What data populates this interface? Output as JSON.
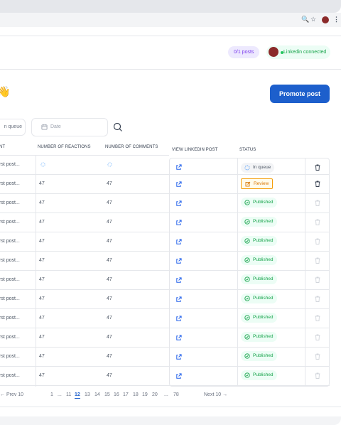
{
  "header": {
    "posts_badge": "0/1 posts",
    "linkedin_status": "Linkedin connected",
    "promote_button": "Promote post"
  },
  "filters": {
    "queue_value": "n queue",
    "date_placeholder": "Date"
  },
  "table": {
    "columns": [
      "NT",
      "NUMBER OF REACTIONS",
      "NUMBER OF COMMENTS",
      "VIEW LINKEDIN POST",
      "STATUS"
    ],
    "rows": [
      {
        "content": "rst post...",
        "reactions": "",
        "comments": "",
        "status": "In queue",
        "status_type": "queue"
      },
      {
        "content": "rst post...",
        "reactions": "47",
        "comments": "47",
        "status": "Review",
        "status_type": "review"
      },
      {
        "content": "rst post...",
        "reactions": "47",
        "comments": "47",
        "status": "Published",
        "status_type": "published"
      },
      {
        "content": "rst post...",
        "reactions": "47",
        "comments": "47",
        "status": "Published",
        "status_type": "published"
      },
      {
        "content": "rst post...",
        "reactions": "47",
        "comments": "47",
        "status": "Published",
        "status_type": "published"
      },
      {
        "content": "rst post...",
        "reactions": "47",
        "comments": "47",
        "status": "Published",
        "status_type": "published"
      },
      {
        "content": "rst post...",
        "reactions": "47",
        "comments": "47",
        "status": "Published",
        "status_type": "published"
      },
      {
        "content": "rst post...",
        "reactions": "47",
        "comments": "47",
        "status": "Published",
        "status_type": "published"
      },
      {
        "content": "rst post...",
        "reactions": "47",
        "comments": "47",
        "status": "Published",
        "status_type": "published"
      },
      {
        "content": "rst post...",
        "reactions": "47",
        "comments": "47",
        "status": "Published",
        "status_type": "published"
      },
      {
        "content": "rst post...",
        "reactions": "47",
        "comments": "47",
        "status": "Published",
        "status_type": "published"
      },
      {
        "content": "rst post...",
        "reactions": "47",
        "comments": "47",
        "status": "Published",
        "status_type": "published"
      }
    ]
  },
  "pagination": {
    "prev": "← Prev 10",
    "next": "Next 10 →",
    "pages": [
      "1",
      "...",
      "11",
      "12",
      "13",
      "14",
      "15",
      "16",
      "17",
      "18",
      "19",
      "20",
      "...",
      "78"
    ],
    "current": "12"
  },
  "colors": {
    "accent": "#1d5fcc",
    "published": "#16a34a",
    "review": "#d97706",
    "posts_badge": "#7c3aed"
  },
  "icons": {
    "wave": "👋",
    "browser_zoom": "🔍",
    "browser_star": "☆",
    "browser_menu": "⋮"
  }
}
